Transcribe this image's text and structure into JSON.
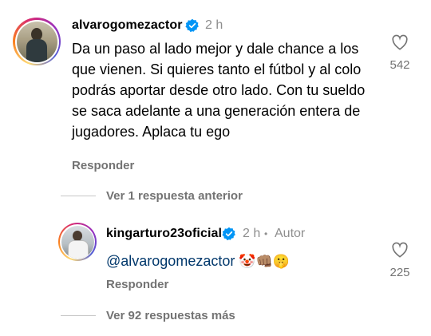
{
  "comments": [
    {
      "username": "alvarogomezactor",
      "time": "2 h",
      "text": "Da un paso al lado mejor y dale chance a los que vienen. Si quieres tanto el fútbol y al colo podrás aportar desde otro lado. Con tu sueldo se saca adelante a una generación entera de jugadores. Aplaca tu ego",
      "reply_label": "Responder",
      "likes": "542",
      "view_replies": "Ver 1 respuesta anterior"
    },
    {
      "username": "kingarturo23oficial",
      "time": "2 h",
      "separator": "•",
      "author_badge": "Autor",
      "mention": "@alvarogomezactor",
      "emojis": "🤡👊🏽🤫",
      "reply_label": "Responder",
      "likes": "225",
      "view_more": "Ver 92 respuestas más"
    }
  ],
  "colors": {
    "verified": "#0095f6",
    "mention": "#00376b",
    "secondary_text": "#737373"
  }
}
